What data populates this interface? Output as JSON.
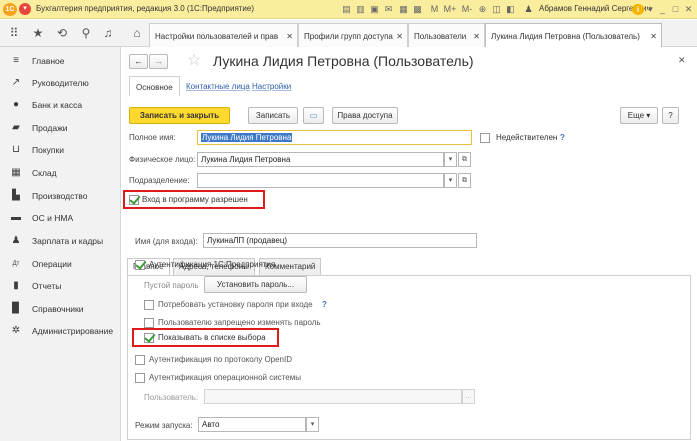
{
  "titlebar": {
    "logo": "1С",
    "title": "Бухгалтерия предприятия, редакция 3.0  (1С:Предприятие)",
    "memory_labels": [
      "M",
      "M+",
      "M-"
    ],
    "user": "Абрамов Геннадий Сергеевич"
  },
  "toolbar": {
    "tabs": [
      {
        "label": "Настройки пользователей и прав"
      },
      {
        "label": "Профили групп доступа"
      },
      {
        "label": "Пользователи"
      },
      {
        "label": "Лукина Лидия Петровна (Пользователь)"
      }
    ]
  },
  "sidebar": {
    "items": [
      {
        "label": "Главное",
        "icon": "menu-icon"
      },
      {
        "label": "Руководителю",
        "icon": "trend-icon"
      },
      {
        "label": "Банк и касса",
        "icon": "coins-icon"
      },
      {
        "label": "Продажи",
        "icon": "bag-icon"
      },
      {
        "label": "Покупки",
        "icon": "cart-icon"
      },
      {
        "label": "Склад",
        "icon": "warehouse-icon"
      },
      {
        "label": "Производство",
        "icon": "factory-icon"
      },
      {
        "label": "ОС и НМА",
        "icon": "truck-icon"
      },
      {
        "label": "Зарплата и кадры",
        "icon": "person-icon"
      },
      {
        "label": "Операции",
        "icon": "dt-kt-icon"
      },
      {
        "label": "Отчеты",
        "icon": "chart-icon"
      },
      {
        "label": "Справочники",
        "icon": "book-icon"
      },
      {
        "label": "Администрирование",
        "icon": "gear-icon"
      }
    ]
  },
  "form": {
    "title": "Лукина Лидия Петровна (Пользователь)",
    "nav": {
      "main": "Основное",
      "contact": "Контактные лица",
      "settings": "Настройки"
    },
    "buttons": {
      "save_close": "Записать и закрыть",
      "save": "Записать",
      "access": "Права доступа",
      "more": "Еще"
    },
    "full_name_label": "Полное имя:",
    "full_name_value": "Лукина Лидия Петровна",
    "invalid_label": "Недействителен",
    "person_label": "Физическое лицо:",
    "person_value": "Лукина Лидия Петровна",
    "division_label": "Подразделение:",
    "division_value": "",
    "login_allowed_label": "Вход в программу разрешен",
    "inner_tabs": [
      "Главное",
      "Адреса, телефоны",
      "Комментарий"
    ],
    "login_name_label": "Имя (для входа):",
    "login_name_value": "ЛукинаЛП (продавец)",
    "auth_1c_label": "Аутентификация 1С:Предприятия",
    "empty_password_label": "Пустой пароль",
    "set_password_label": "Установить пароль...",
    "require_password_label": "Потребовать установку пароля при входе",
    "deny_change_label": "Пользователю запрещено изменять пароль",
    "show_in_list_label": "Показывать в списке выбора",
    "auth_openid_label": "Аутентификация по протоколу OpenID",
    "auth_os_label": "Аутентификация операционной системы",
    "os_user_label": "Пользователь:",
    "os_user_value": "",
    "launch_mode_label": "Режим запуска:",
    "launch_mode_value": "Авто",
    "help": "?"
  },
  "colors": {
    "accent_button": "#ffd92e",
    "highlight_box": "#e01a1a",
    "title_bar": "#fbed9e"
  }
}
